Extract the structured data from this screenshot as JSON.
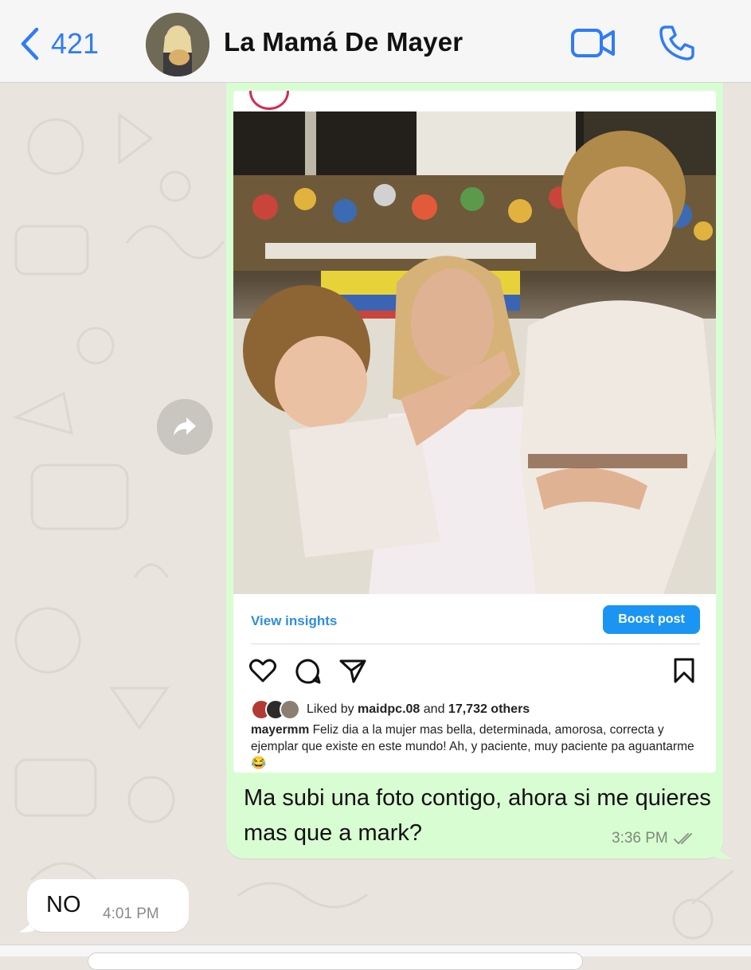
{
  "header": {
    "back_count": "421",
    "contact_name": "La Mamá De Mayer"
  },
  "colors": {
    "accent": "#2f7cf6",
    "outgoing_bubble": "#d9fdd3",
    "incoming_bubble": "#ffffff",
    "instagram_blue": "#1a95f3"
  },
  "outgoing_message": {
    "instagram_post": {
      "view_insights_label": "View insights",
      "boost_label": "Boost post",
      "liked_by_prefix": "Liked by",
      "liked_by_user": "maidpc.08",
      "liked_by_and": "and",
      "liked_by_others": "17,732 others",
      "caption_user": "mayermm",
      "caption_text": "Feliz dia a la mujer mas bella, determinada, amorosa, correcta y ejemplar que existe en este mundo! Ah, y paciente, muy paciente pa aguantarme 😂"
    },
    "text": "Ma subi una foto contigo, ahora si me quieres mas que a mark?",
    "time": "3:36 PM"
  },
  "incoming_message": {
    "text": "NO",
    "time": "4:01 PM"
  }
}
